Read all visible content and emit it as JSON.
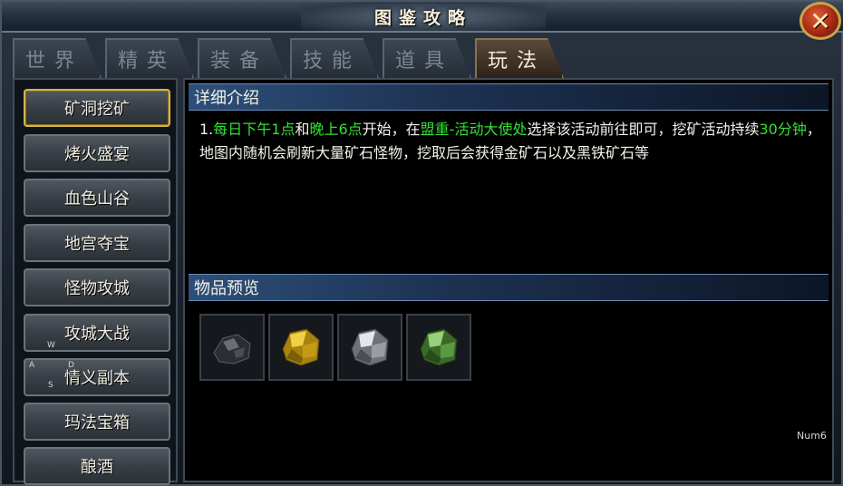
{
  "window": {
    "title": "图鉴攻略",
    "close_symbol": "✕"
  },
  "tabs": [
    {
      "label": "世界",
      "active": false
    },
    {
      "label": "精英",
      "active": false
    },
    {
      "label": "装备",
      "active": false
    },
    {
      "label": "技能",
      "active": false
    },
    {
      "label": "道具",
      "active": false
    },
    {
      "label": "玩法",
      "active": true
    }
  ],
  "categories": [
    {
      "label": "矿洞挖矿",
      "selected": true
    },
    {
      "label": "烤火盛宴",
      "selected": false
    },
    {
      "label": "血色山谷",
      "selected": false
    },
    {
      "label": "地宫夺宝",
      "selected": false
    },
    {
      "label": "怪物攻城",
      "selected": false
    },
    {
      "label": "攻城大战",
      "selected": false
    },
    {
      "label": "情义副本",
      "selected": false
    },
    {
      "label": "玛法宝箱",
      "selected": false
    },
    {
      "label": "酿酒",
      "selected": false
    }
  ],
  "details": {
    "header": "详细介绍",
    "segments": [
      {
        "text": "1.",
        "highlight": false
      },
      {
        "text": "每日下午1点",
        "highlight": true
      },
      {
        "text": "和",
        "highlight": false
      },
      {
        "text": "晚上6点",
        "highlight": true
      },
      {
        "text": "开始，在",
        "highlight": false
      },
      {
        "text": "盟重-活动大使处",
        "highlight": true
      },
      {
        "text": "选择该活动前往即可，挖矿活动持续",
        "highlight": false
      },
      {
        "text": "30分钟",
        "highlight": true
      },
      {
        "text": "，地图内随机会刷新大量矿石怪物，挖取后会获得金矿石以及黑铁矿石等",
        "highlight": false
      }
    ]
  },
  "preview": {
    "header": "物品预览",
    "items": [
      {
        "icon": "black-iron-ore-icon",
        "color": "#3a3d44"
      },
      {
        "icon": "gold-ore-icon",
        "color": "#c9a21c"
      },
      {
        "icon": "silver-ore-icon",
        "color": "#9a9ea4"
      },
      {
        "icon": "jade-ore-icon",
        "color": "#4f8a3a"
      }
    ]
  },
  "overlay": {
    "keys": {
      "w": "W",
      "a": "A",
      "d": "D",
      "s": "S"
    },
    "numpad": "Num6"
  },
  "colors": {
    "highlight": "#34e034",
    "selected_border": "#d6b44a"
  }
}
